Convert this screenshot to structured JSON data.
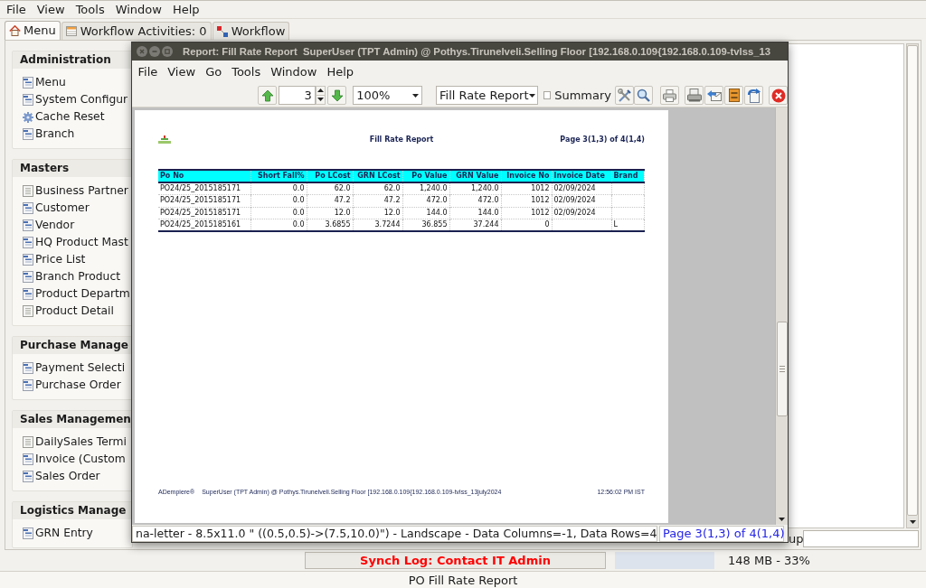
{
  "menu_bar": [
    "File",
    "View",
    "Tools",
    "Window",
    "Help"
  ],
  "tabs": [
    {
      "label": "Menu",
      "kind": "home",
      "selected": true
    },
    {
      "label": "Workflow Activities: 0",
      "kind": "activities",
      "selected": false
    },
    {
      "label": "Workflow",
      "kind": "workflow",
      "selected": false
    }
  ],
  "sidebar": [
    {
      "title": "Administration",
      "items": [
        {
          "label": "Menu",
          "kind": "window"
        },
        {
          "label": "System Configur",
          "kind": "window"
        },
        {
          "label": "Cache Reset",
          "kind": "process"
        },
        {
          "label": "Branch",
          "kind": "window"
        }
      ]
    },
    {
      "title": "Masters",
      "items": [
        {
          "label": "Business Partner",
          "kind": "form"
        },
        {
          "label": "Customer",
          "kind": "window"
        },
        {
          "label": "Vendor",
          "kind": "window"
        },
        {
          "label": "HQ Product Mast",
          "kind": "window"
        },
        {
          "label": "Price List",
          "kind": "window"
        },
        {
          "label": "Branch Product",
          "kind": "window"
        },
        {
          "label": "Product Departm",
          "kind": "window"
        },
        {
          "label": "Product Detail",
          "kind": "form"
        }
      ]
    },
    {
      "title": "Purchase Manage",
      "items": [
        {
          "label": "Payment Selecti",
          "kind": "window"
        },
        {
          "label": "Purchase Order",
          "kind": "window"
        }
      ]
    },
    {
      "title": "Sales Managemen",
      "items": [
        {
          "label": "DailySales Termi",
          "kind": "form"
        },
        {
          "label": "Invoice (Custom",
          "kind": "window"
        },
        {
          "label": "Sales Order",
          "kind": "window"
        }
      ]
    },
    {
      "title": "Logistics Manage",
      "items": [
        {
          "label": "GRN Entry",
          "kind": "window"
        }
      ]
    }
  ],
  "lookup": {
    "label": "up"
  },
  "report_window": {
    "title": "Report: Fill Rate Report  SuperUser (TPT Admin) @ Pothys.Tirunelveli.Selling Floor [192.168.0.109{192.168.0.109-tvlss_13",
    "menu_bar": [
      "File",
      "View",
      "Go",
      "Tools",
      "Window",
      "Help"
    ],
    "toolbar": {
      "page": "3",
      "zoom": "100%",
      "report": "Fill Rate Report",
      "summary": {
        "label": "Summary",
        "checked": false
      }
    },
    "page": {
      "title": "Fill Rate Report",
      "page_info": "Page 3(1,3) of 4(1,4)",
      "table": {
        "columns": [
          {
            "label": "Po No",
            "kind": "text"
          },
          {
            "label": "Short Fall%",
            "kind": "number"
          },
          {
            "label": "Po LCost",
            "kind": "number"
          },
          {
            "label": "GRN LCost",
            "kind": "number"
          },
          {
            "label": "Po Value",
            "kind": "number"
          },
          {
            "label": "GRN Value",
            "kind": "number"
          },
          {
            "label": "Invoice No",
            "kind": "number"
          },
          {
            "label": "Invoice Date",
            "kind": "text"
          },
          {
            "label": "Brand",
            "kind": "text"
          }
        ],
        "rows": [
          [
            "PO24/25_2015185171",
            "0.0",
            "62.0",
            "62.0",
            "1,240.0",
            "1,240.0",
            "1012",
            "02/09/2024",
            null
          ],
          [
            "PO24/25_2015185171",
            "0.0",
            "47.2",
            "47.2",
            "472.0",
            "472.0",
            "1012",
            "02/09/2024",
            null
          ],
          [
            "PO24/25_2015185171",
            "0.0",
            "12.0",
            "12.0",
            "144.0",
            "144.0",
            "1012",
            "02/09/2024",
            null
          ],
          [
            "PO24/25_2015185161",
            "0.0",
            "3.6855",
            "3.7244",
            "36.855",
            "37.244",
            "0",
            null,
            "L"
          ]
        ]
      },
      "footer": {
        "brand": "ADempiere®",
        "user": "SuperUser (TPT Admin) @ Pothys.Tirunelveli.Selling Floor [192.168.0.109{192.168.0.109-tvlss_13july2024",
        "time": "12:56:02 PM IST"
      }
    },
    "status": {
      "paper": "na-letter - 8.5x11.0 \" ((0.5,0.5)->(7.5,10.0)\") - Landscape - Data Columns=-1, Data Rows=4",
      "page": "Page 3(1,3) of 4(1,4)"
    }
  },
  "status_bar": {
    "sync_log": "Synch Log: Contact IT Admin",
    "memory": "148 MB - 33%"
  },
  "window_footer": "PO Fill Rate Report"
}
